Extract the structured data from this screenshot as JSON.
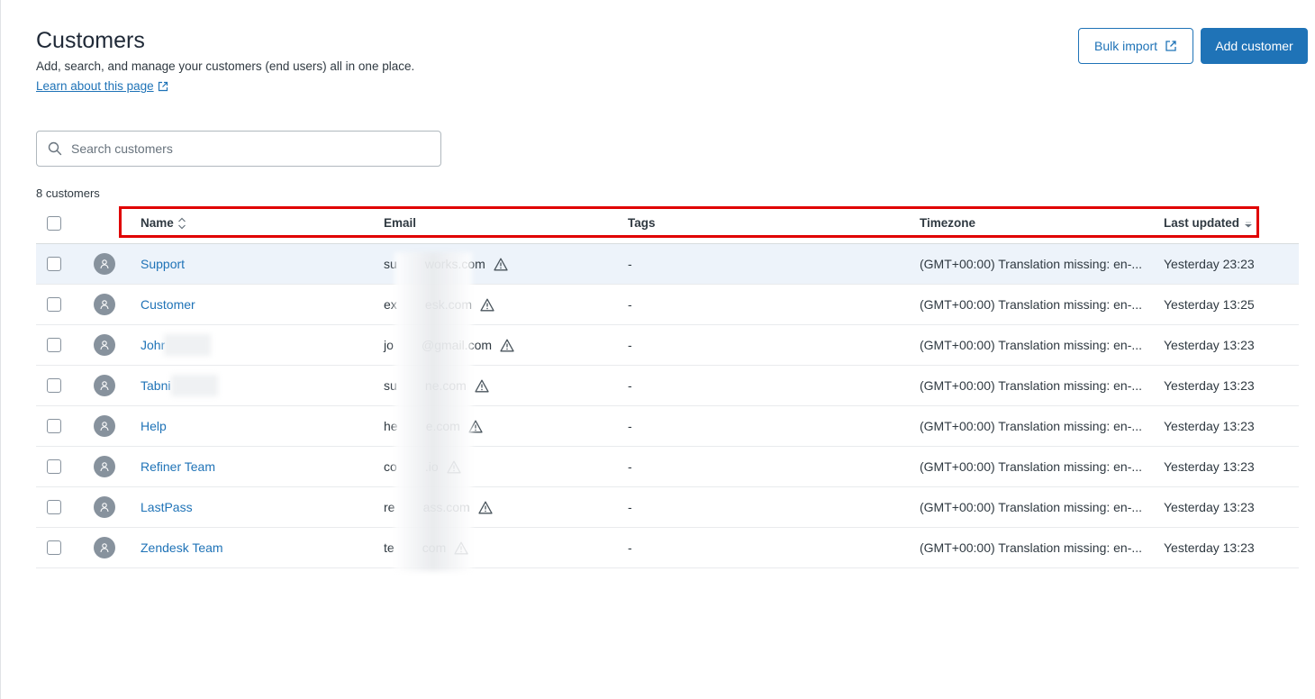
{
  "page": {
    "title": "Customers",
    "subtitle": "Add, search, and manage your customers (end users) all in one place.",
    "learn_link": "Learn about this page"
  },
  "actions": {
    "bulk_import": "Bulk import",
    "add_customer": "Add customer"
  },
  "search": {
    "placeholder": "Search customers"
  },
  "count_label": "8 customers",
  "table": {
    "columns": {
      "name": "Name",
      "email": "Email",
      "tags": "Tags",
      "timezone": "Timezone",
      "last_updated": "Last updated"
    },
    "rows": [
      {
        "name": "Support",
        "email": "su        works.com",
        "tags": "-",
        "timezone": "(GMT+00:00) Translation missing: en-...",
        "updated": "Yesterday 23:23"
      },
      {
        "name": "Customer",
        "email": "ex        esk.com",
        "tags": "-",
        "timezone": "(GMT+00:00) Translation missing: en-...",
        "updated": "Yesterday 13:25"
      },
      {
        "name": "Johr",
        "email": "jo        @gmail.com",
        "tags": "-",
        "timezone": "(GMT+00:00) Translation missing: en-...",
        "updated": "Yesterday 13:23"
      },
      {
        "name": "Tabni",
        "email": "su        ne.com",
        "tags": "-",
        "timezone": "(GMT+00:00) Translation missing: en-...",
        "updated": "Yesterday 13:23"
      },
      {
        "name": "Help",
        "email": "he        e.com",
        "tags": "-",
        "timezone": "(GMT+00:00) Translation missing: en-...",
        "updated": "Yesterday 13:23"
      },
      {
        "name": "Refiner Team",
        "email": "co        .io",
        "tags": "-",
        "timezone": "(GMT+00:00) Translation missing: en-...",
        "updated": "Yesterday 13:23"
      },
      {
        "name": "LastPass",
        "email": "re        ass.com",
        "tags": "-",
        "timezone": "(GMT+00:00) Translation missing: en-...",
        "updated": "Yesterday 13:23"
      },
      {
        "name": "Zendesk Team",
        "email": "te        com",
        "tags": "-",
        "timezone": "(GMT+00:00) Translation missing: en-...",
        "updated": "Yesterday 13:23"
      }
    ]
  },
  "colors": {
    "accent": "#1f73b7",
    "highlight_row": "#edf3fa",
    "annotation_box": "#e00000"
  },
  "icons": {
    "external": "external-link-icon",
    "search": "search-icon",
    "avatar": "user-icon",
    "warning": "warning-icon",
    "sort": "sort-icon",
    "sort_desc": "sort-descending-icon"
  }
}
